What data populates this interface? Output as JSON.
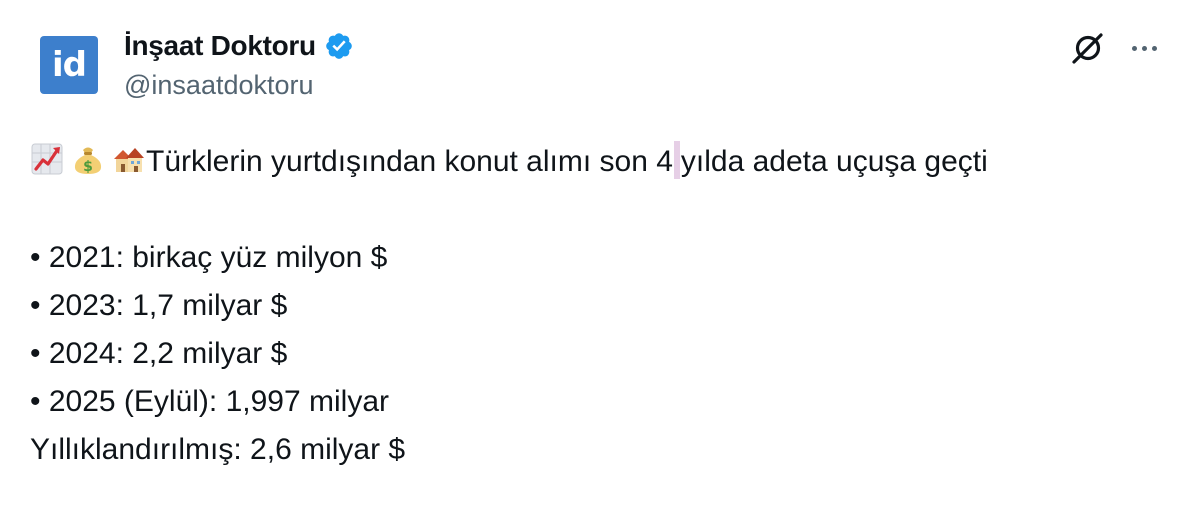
{
  "author": {
    "avatar_text": "id",
    "display_name": "İnşaat Doktoru",
    "handle": "@insaatdoktoru",
    "verified": true,
    "verified_color": "#1d9bf0",
    "avatar_color": "#3d7fcc"
  },
  "actions": {
    "grok_icon": "grok-icon",
    "more_icon": "more-icon"
  },
  "tweet": {
    "emojis": [
      "chart-increasing-emoji",
      "money-bag-emoji",
      "houses-emoji"
    ],
    "headline_part1": "Türklerin yurtdışından konut alımı son 4",
    "headline_part2": "yılda adeta uçuşa geçti",
    "lines": [
      "• 2021: birkaç yüz milyon $",
      "• 2023: 1,7 milyar $",
      "• 2024: 2,2 milyar $",
      "• 2025 (Eylül): 1,997 milyar",
      "Yıllıklandırılmış: 2,6 milyar $"
    ]
  }
}
